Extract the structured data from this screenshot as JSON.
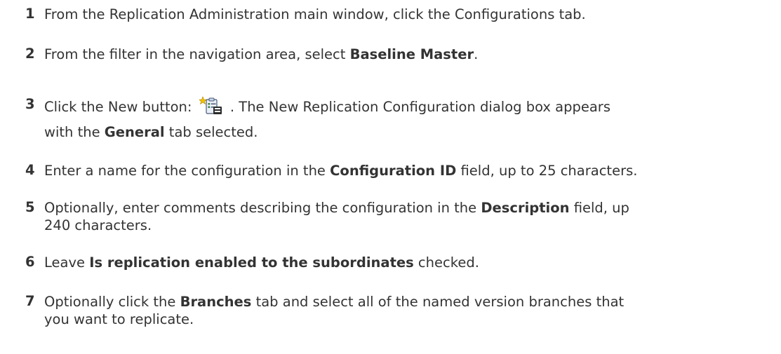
{
  "steps": [
    {
      "num": "1",
      "t1": "From the Replication Administration main window, click the Configurations tab."
    },
    {
      "num": "2",
      "pre": "From the filter in the navigation area, select ",
      "bold": "Baseline Master",
      "post": "."
    },
    {
      "num": "3",
      "pre": "Click the New button: ",
      "post": " . The New Replication Configuration dialog box appears",
      "line2_pre": "with the ",
      "line2_bold": "General",
      "line2_post": " tab selected.",
      "icon": "new-configuration-icon"
    },
    {
      "num": "4",
      "pre": "Enter a name for the configuration in the ",
      "bold": "Configuration ID",
      "post": " field, up to 25 characters."
    },
    {
      "num": "5",
      "pre": "Optionally, enter comments describing the configuration in the ",
      "bold": "Description",
      "post": " field, up",
      "line2": "240 characters."
    },
    {
      "num": "6",
      "pre": "Leave ",
      "bold": "Is replication enabled to the subordinates",
      "post": " checked."
    },
    {
      "num": "7",
      "pre": "Optionally click the ",
      "bold": "Branches",
      "post": " tab and select all of the named version branches that",
      "line2": "you want to replicate."
    }
  ]
}
